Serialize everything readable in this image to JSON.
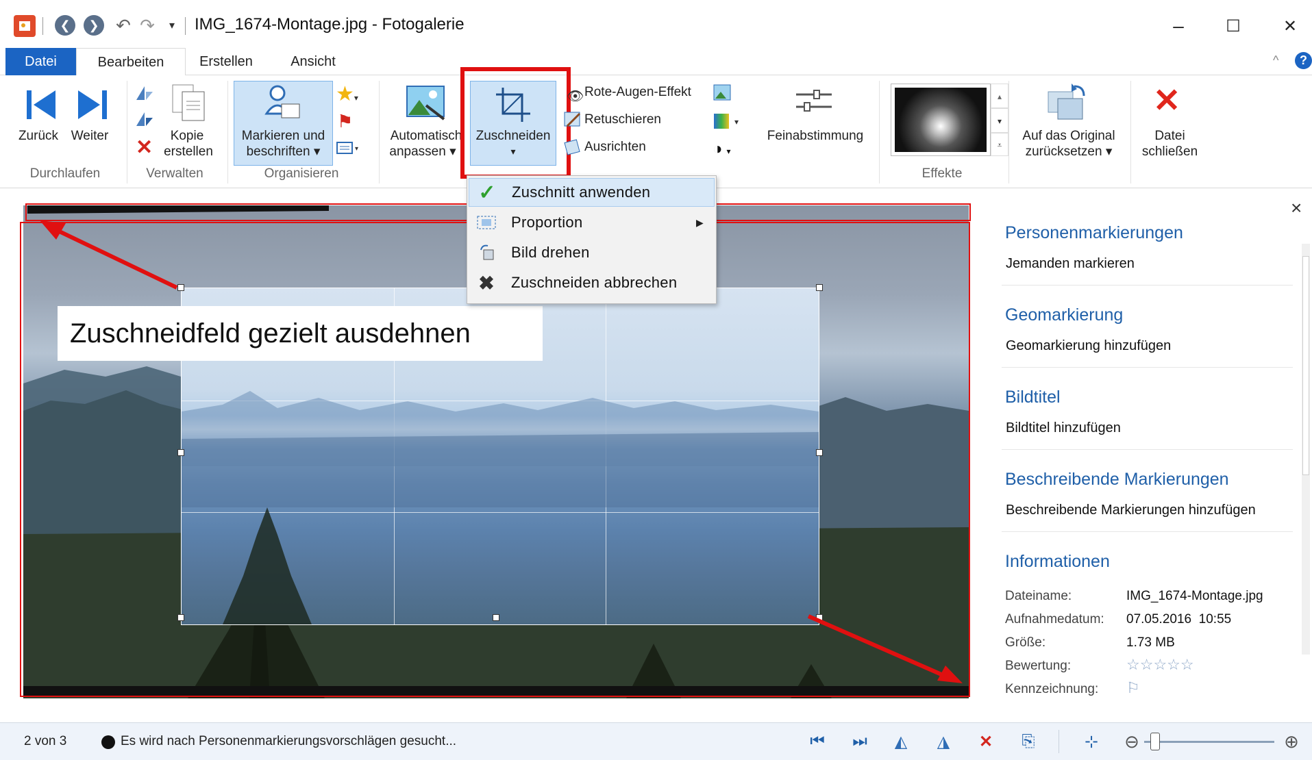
{
  "window": {
    "title": "IMG_1674-Montage.jpg - Fotogalerie",
    "minimize": "–",
    "maximize": "☐",
    "close": "✕"
  },
  "tabs": [
    "Datei",
    "Bearbeiten",
    "Erstellen",
    "Ansicht"
  ],
  "ribbon": {
    "durchlaufen": {
      "group": "Durchlaufen",
      "back": "Zurück",
      "forward": "Weiter"
    },
    "verwalten": {
      "group": "Verwalten",
      "copy_line1": "Kopie",
      "copy_line2": "erstellen"
    },
    "organisieren": {
      "group": "Organisieren",
      "tag_line1": "Markieren und",
      "tag_line2": "beschriften ▾"
    },
    "auto": {
      "line1": "Automatisch",
      "line2": "anpassen ▾"
    },
    "crop": {
      "label": "Zuschneiden",
      "arrow": "▾"
    },
    "fix": {
      "redeye": "Rote-Augen-Effekt",
      "retouch": "Retuschieren",
      "straighten": "Ausrichten"
    },
    "finetune": "Feinabstimmung",
    "effects_group": "Effekte",
    "revert_line1": "Auf das Original",
    "revert_line2": "zurücksetzen ▾",
    "close_line1": "Datei",
    "close_line2": "schließen"
  },
  "crop_menu": {
    "apply": "Zuschnitt anwenden",
    "proportion": "Proportion",
    "rotate": "Bild drehen",
    "cancel": "Zuschneiden abbrechen"
  },
  "annotation": "Zuschneidfeld gezielt ausdehnen",
  "side_panel": {
    "close": "×",
    "people_heading": "Personenmarkierungen",
    "people_action": "Jemanden markieren",
    "geo_heading": "Geomarkierung",
    "geo_action": "Geomarkierung hinzufügen",
    "caption_heading": "Bildtitel",
    "caption_action": "Bildtitel hinzufügen",
    "desc_heading": "Beschreibende Markierungen",
    "desc_action": "Beschreibende Markierungen hinzufügen",
    "info_heading": "Informationen",
    "info": [
      {
        "key": "Dateiname:",
        "value": "IMG_1674-Montage.jpg"
      },
      {
        "key": "Aufnahmedatum:",
        "value": "07.05.2016  10:55"
      },
      {
        "key": "Größe:",
        "value": "1.73 MB"
      },
      {
        "key": "Bewertung:",
        "value": "☆☆☆☆☆"
      },
      {
        "key": "Kennzeichnung:",
        "value": "⚐"
      }
    ]
  },
  "status": {
    "position": "2 von 3",
    "message": "Es wird nach Personenmarkierungsvorschlägen gesucht...",
    "zoom_level": 0.05
  },
  "colors": {
    "accent": "#1b64c3",
    "highlight_red": "#e01010",
    "link_blue": "#1f5fa8"
  }
}
